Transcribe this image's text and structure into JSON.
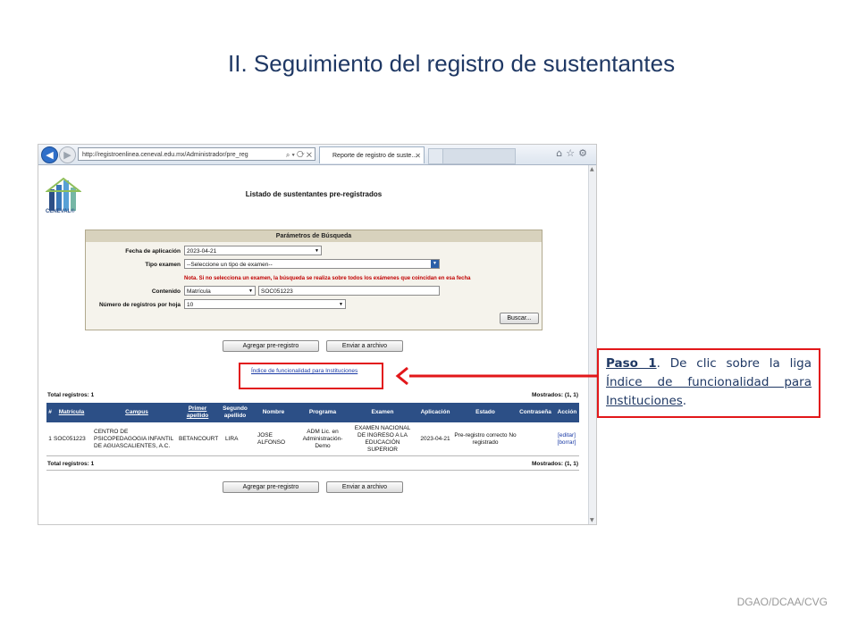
{
  "slide": {
    "title": "II. Seguimiento del registro de sustentantes",
    "footer": "DGAO/DCAA/CVG"
  },
  "browser": {
    "url": "http://registroenlinea.ceneval.edu.mx/Administrador/pre_reg",
    "tab_title": "Reporte de registro de suste...",
    "logo_text": "CENEVAL®"
  },
  "page": {
    "heading": "Listado de sustentantes pre-registrados",
    "params": {
      "title": "Parámetros de Búsqueda",
      "fecha_label": "Fecha de aplicación",
      "fecha_value": "2023-04-21",
      "tipo_label": "Tipo examen",
      "tipo_value": "--Seleccione un tipo de examen--",
      "note": "Nota. Si no selecciona un examen, la búsqueda se realiza sobre todos los exámenes que coincidan en esa fecha",
      "contenido_label": "Contenido",
      "contenido_value": "Matrícula",
      "contenido_text": "SOC051223",
      "numero_label": "Número de registros por hoja",
      "numero_value": "10",
      "buscar": "Buscar..."
    },
    "agregar_label": "Agregar pre-registro",
    "enviar_label": "Enviar a archivo",
    "indice_link": "Índice de funcionalidad para Instituciones",
    "total_label": "Total registros: 1",
    "mostrados_label": "Mostrados: (1, 1)",
    "table": {
      "headers": [
        "#",
        "Matrícula",
        "Campus",
        "Primer apellido",
        "Segundo apellido",
        "Nombre",
        "Programa",
        "Examen",
        "Aplicación",
        "Estado",
        "Contraseña",
        "Acción"
      ],
      "row": {
        "num": "1",
        "matricula": "SOC051223",
        "campus": "CENTRO DE PSICOPEDAGOGIA INFANTIL DE AGUASCALIENTES, A.C.",
        "primer": "BETANCOURT",
        "segundo": "LIRA",
        "nombre": "JOSE ALFONSO",
        "programa": "ADM Lic. en Administración-Demo",
        "examen": "EXAMEN NACIONAL DE INGRESO A LA EDUCACIÓN SUPERIOR",
        "aplicacion": "2023-04-21",
        "estado": "Pre-registro correcto No registrado",
        "editar": "[editar]",
        "borrar": "[borrar]"
      }
    }
  },
  "callout": {
    "step": "Paso 1",
    "text": ". De clic sobre la liga ",
    "link": "Índice de funcionalidad para Instituciones",
    "end": "."
  },
  "colors": {
    "accent": "#e2171a",
    "header_blue": "#2c4f86",
    "title": "#1f3864"
  }
}
